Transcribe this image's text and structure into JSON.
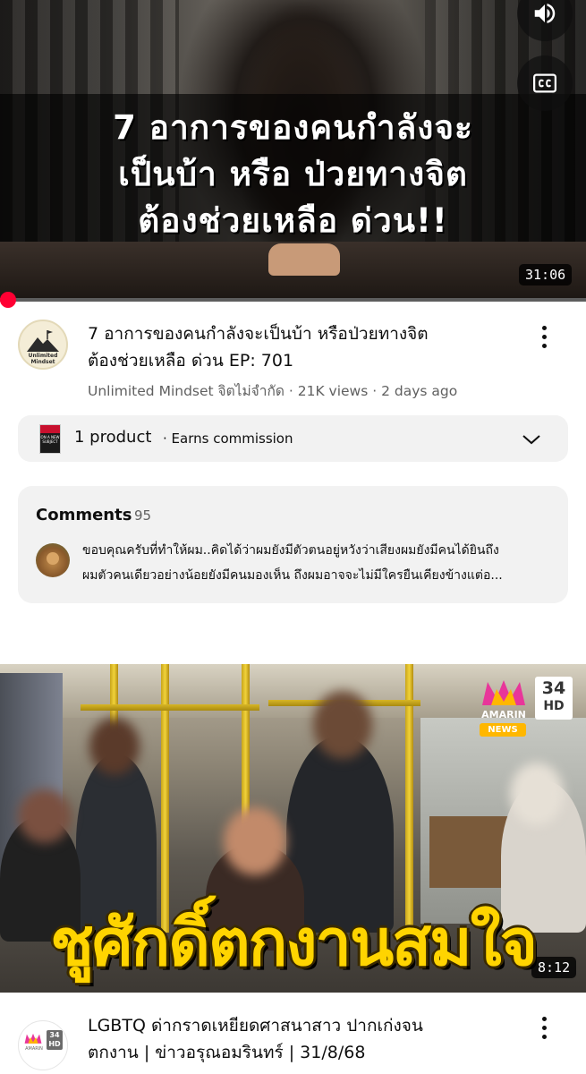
{
  "video1": {
    "thumbnail_title_lines": [
      "7 อาการของคนกำลังจะ",
      "เป็นบ้า หรือ ป่วยทางจิต",
      "ต้องช่วยเหลือ ด่วน!!"
    ],
    "duration": "31:06",
    "progress_fraction": 0.0,
    "title_lines": [
      "7 อาการของคนกำลังจะเป็นบ้า หรือป่วยทางจิต",
      "ต้องช่วยเหลือ ด่วน  EP: 701"
    ],
    "channel": "Unlimited Mindset จิตไม่จำกัด",
    "views": "21K views",
    "age": "2 days ago",
    "channel_avatar_text": [
      "Unlimited",
      "Mindset"
    ]
  },
  "product": {
    "label": "1 product",
    "note": "· Earns commission",
    "thumb_text": "ON A NEW SUBJECT"
  },
  "comments": {
    "heading": "Comments",
    "count": "95",
    "preview_lines": [
      "ขอบคุณครับที่ทำให้ผม..คิดได้ว่าผมยังมีตัวตนอยู่หวังว่าเสียงผมยังมีคนได้ยินถึง",
      "ผมตัวคนเดียวอย่างน้อยยังมีคนมองเห็น ถึงผมอาจจะไม่มีใครยืนเคียงข้างแต่อ..."
    ]
  },
  "video2": {
    "caption": "ชูศักดิ์ตกงานสมใจ",
    "duration": "8:12",
    "logo_brand": "AMARIN",
    "logo_news": "NEWS",
    "channel_number": "34",
    "channel_hd": "HD",
    "title_lines": [
      "LGBTQ ด่ากราดเหยียดศาสนาสาว ปากเก่งจน",
      "ตกงาน | ข่าวอรุณอมรินทร์ | 31/8/68"
    ],
    "avatar_brand": "AMARIN",
    "avatar_number": "34",
    "avatar_hd": "HD"
  },
  "icons": {
    "volume": "volume-icon",
    "cc": "closed-captions-icon",
    "more": "more-vert-icon",
    "chevron": "chevron-down-icon"
  },
  "colors": {
    "progress_accent": "#ff0033",
    "caption_yellow": "#ffd400",
    "card_bg": "#f2f2f2",
    "meta_gray": "#606060"
  }
}
